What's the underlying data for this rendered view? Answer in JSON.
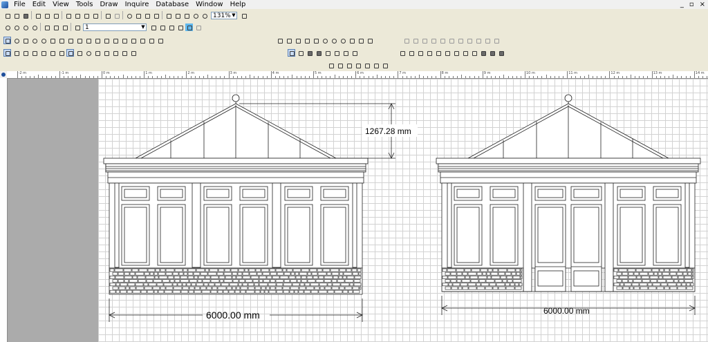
{
  "menubar": {
    "items": [
      "File",
      "Edit",
      "View",
      "Tools",
      "Draw",
      "Inquire",
      "Database",
      "Window",
      "Help"
    ],
    "window_controls": [
      "_",
      "▫",
      "×"
    ]
  },
  "toolbar": {
    "zoom_value": "131%",
    "layer_value": "1"
  },
  "drawing": {
    "left_elevation": {
      "height_dimension": "1267.28 mm",
      "width_dimension": "6000.00 mm"
    },
    "right_elevation": {
      "width_dimension": "6000.00 mm"
    }
  },
  "ruler": {
    "labels": [
      "-2 m",
      "-1 m",
      "0 m",
      "1 m",
      "2 m",
      "3 m",
      "4 m",
      "5 m",
      "6 m",
      "7 m",
      "8 m",
      "9 m",
      "10 m",
      "11 m",
      "12 m",
      "13 m",
      "14 m"
    ]
  }
}
